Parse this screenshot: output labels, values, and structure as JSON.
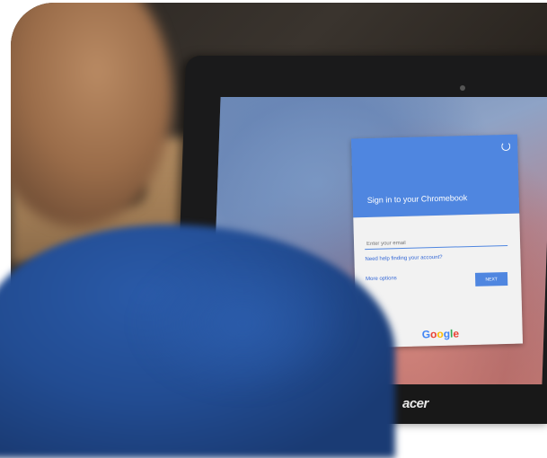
{
  "card": {
    "title": "Sign in to your Chromebook",
    "email_placeholder": "Enter your email",
    "help_link": "Need help finding your account?",
    "more_options": "More options",
    "next_label": "NEXT",
    "logo_letters": [
      "G",
      "o",
      "o",
      "g",
      "l",
      "e"
    ]
  },
  "device": {
    "brand": "acer"
  },
  "colors": {
    "card_header": "#4f86e0",
    "card_body": "#f2f2f2",
    "shirt": "#224c92"
  },
  "icons": {
    "refresh": "refresh-icon"
  }
}
